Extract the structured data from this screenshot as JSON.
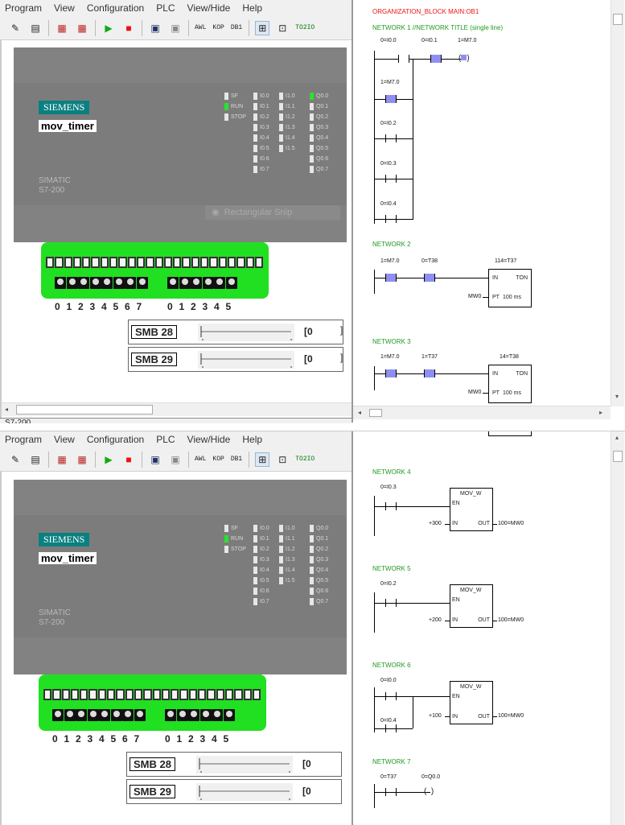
{
  "menu": [
    "Program",
    "View",
    "Configuration",
    "PLC",
    "View/Hide",
    "Help"
  ],
  "toolbar": {
    "awl": "AWL",
    "kop": "KOP",
    "db1": "DB1",
    "tozio": "TO2IO"
  },
  "plc": {
    "brand": "SIEMENS",
    "project": "mov_timer",
    "model_line1": "SIMATIC",
    "model_line2": "S7-200",
    "status_leds": [
      "SF",
      "RUN",
      "STOP"
    ],
    "inputs_a": [
      "I0.0",
      "I0.1",
      "I0.2",
      "I0.3",
      "I0.4",
      "I0.5",
      "I0.6",
      "I0.7"
    ],
    "inputs_b": [
      "I1.0",
      "I1.1",
      "I1.2",
      "I1.3",
      "I1.4",
      "I1.5"
    ],
    "outputs": [
      "Q0.0",
      "Q0.1",
      "Q0.2",
      "Q0.3",
      "Q0.4",
      "Q0.5",
      "Q0.6",
      "Q0.7"
    ]
  },
  "snip_overlay": "Rectangular Snip",
  "switch_numbers_a": [
    "0",
    "1",
    "2",
    "3",
    "4",
    "5",
    "6",
    "7"
  ],
  "switch_numbers_b": [
    "0",
    "1",
    "2",
    "3",
    "4",
    "5"
  ],
  "smb28": {
    "label": "SMB 28",
    "value": "0"
  },
  "smb29": {
    "label": "SMB 29",
    "value": "0"
  },
  "status_title": "S7-200",
  "editor_top": {
    "block_title": "ORGANIZATION_BLOCK MAIN:OB1",
    "network1_title": "NETWORK 1 //NETWORK TITLE (single line)",
    "n1": {
      "c1": "0=I0.0",
      "c2": "0=I0.1",
      "coil": "1=M7.0",
      "c3": "1=M7.0",
      "c4": "0=I0.2",
      "c5": "0=I0.3",
      "c6": "0=I0.4"
    },
    "network2": "NETWORK 2",
    "n2": {
      "c1": "1=M7.0",
      "c2": "0=T38",
      "timer": "114=T37",
      "in": "IN",
      "ton": "TON",
      "pt": "PT",
      "ptval": "100 ms",
      "mw": "MW0"
    },
    "network3": "NETWORK 3",
    "n3": {
      "c1": "1=M7.0",
      "c2": "1=T37",
      "timer": "14=T38",
      "in": "IN",
      "ton": "TON",
      "pt": "PT",
      "ptval": "100 ms",
      "mw": "MW0"
    }
  },
  "editor_bottom": {
    "network4": "NETWORK 4",
    "n4": {
      "c1": "0=I0.3",
      "box": "MOV_W",
      "en": "EN",
      "in": "IN",
      "out": "OUT",
      "inval": "+300",
      "outval": "100=MW0"
    },
    "network5": "NETWORK 5",
    "n5": {
      "c1": "0=I0.2",
      "box": "MOV_W",
      "en": "EN",
      "in": "IN",
      "out": "OUT",
      "inval": "+200",
      "outval": "100=MW0"
    },
    "network6": "NETWORK 6",
    "n6": {
      "c1": "0=I0.0",
      "c2": "0=I0.4",
      "box": "MOV_W",
      "en": "EN",
      "in": "IN",
      "out": "OUT",
      "inval": "+100",
      "outval": "100=MW0"
    },
    "network7": "NETWORK 7",
    "n7": {
      "c1": "0=T37",
      "coil": "0=Q0.0"
    }
  },
  "colors": {
    "plc_gray": "#7c7c7c",
    "led_on": "#2de02d",
    "terminal_green": "#21e021",
    "network_green": "#1e9b1e",
    "highlight": "#8f8ff3",
    "brand": "#0b8080"
  }
}
